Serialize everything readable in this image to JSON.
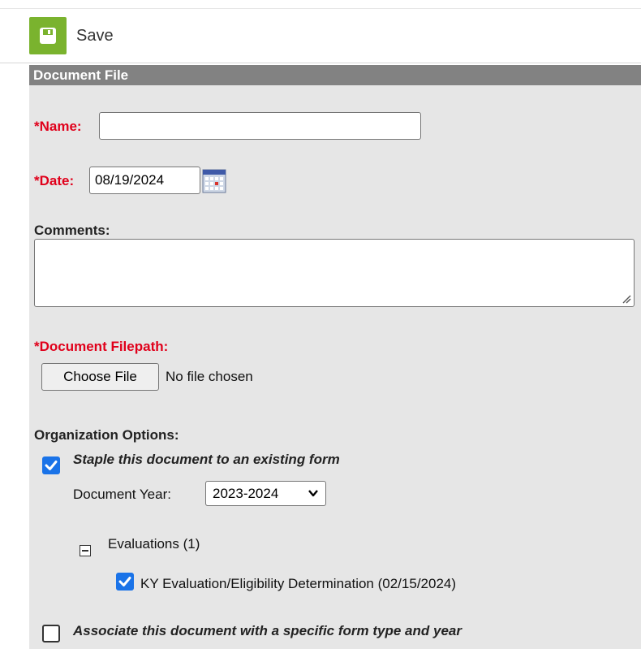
{
  "toolbar": {
    "save_label": "Save",
    "save_icon": "floppy-disk-icon",
    "accent_color": "#7ab32e"
  },
  "panel": {
    "header": "Document File"
  },
  "form": {
    "name_label": "*Name:",
    "name_value": "",
    "date_label": "*Date:",
    "date_value": "08/19/2024",
    "comments_label": "Comments:",
    "comments_value": "",
    "filepath_label": "*Document Filepath:",
    "choose_file_label": "Choose File",
    "no_file_text": "No file chosen",
    "org_options_label": "Organization Options:",
    "staple_label": "Staple this document to an existing form",
    "staple_checked": true,
    "doc_year_label": "Document Year:",
    "doc_year_value": "2023-2024",
    "evaluations_label": "Evaluations (1)",
    "evaluation_item_label": "KY Evaluation/Eligibility Determination (02/15/2024)",
    "evaluation_item_checked": true,
    "associate_label": "Associate this document with a specific form type and year",
    "associate_checked": false
  },
  "colors": {
    "required": "#e0001b",
    "checkbox": "#1a73e8",
    "header_bg": "#828282",
    "panel_bg": "#e6e6e6"
  }
}
